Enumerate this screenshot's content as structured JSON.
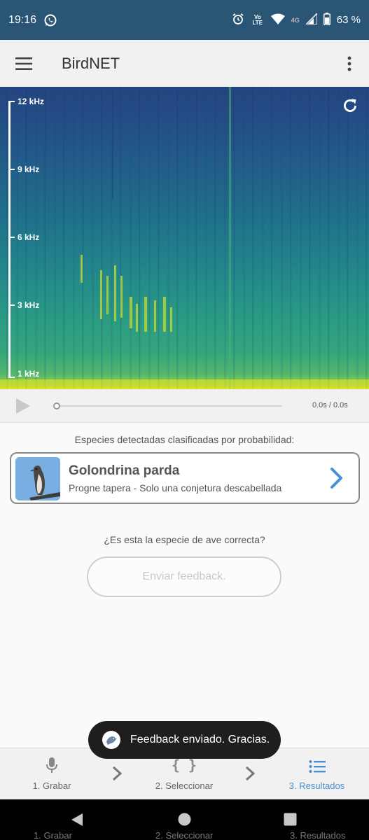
{
  "status_bar": {
    "time": "19:16",
    "volte_label": "Vo LTE",
    "network_label": "4G",
    "battery": "63 %"
  },
  "app_bar": {
    "title": "BirdNET"
  },
  "spectrogram": {
    "axis_labels": [
      "12 kHz",
      "9 kHz",
      "6 kHz",
      "3 kHz",
      "1 kHz"
    ]
  },
  "player": {
    "time_readout": "0.0s / 0.0s"
  },
  "results": {
    "heading": "Especies detectadas clasificadas por probabilidad:",
    "items": [
      {
        "common_name": "Golondrina parda",
        "scientific_name": "Progne tapera - Solo una conjetura descabellada"
      }
    ]
  },
  "feedback": {
    "question": "¿Es esta la especie de ave correcta?",
    "button_label": "Enviar feedback."
  },
  "toast": {
    "message": "Feedback enviado. Gracias."
  },
  "bottom_nav": {
    "items": [
      {
        "label": "1. Grabar",
        "icon": "microphone-icon"
      },
      {
        "label": "2. Seleccionar",
        "icon": "braces-icon"
      },
      {
        "label": "3. Resultados",
        "icon": "list-icon",
        "active": true
      }
    ]
  },
  "colors": {
    "status_bar": "#2b5574",
    "accent": "#4a8fd1",
    "toast_bg": "#1e1e1e"
  }
}
